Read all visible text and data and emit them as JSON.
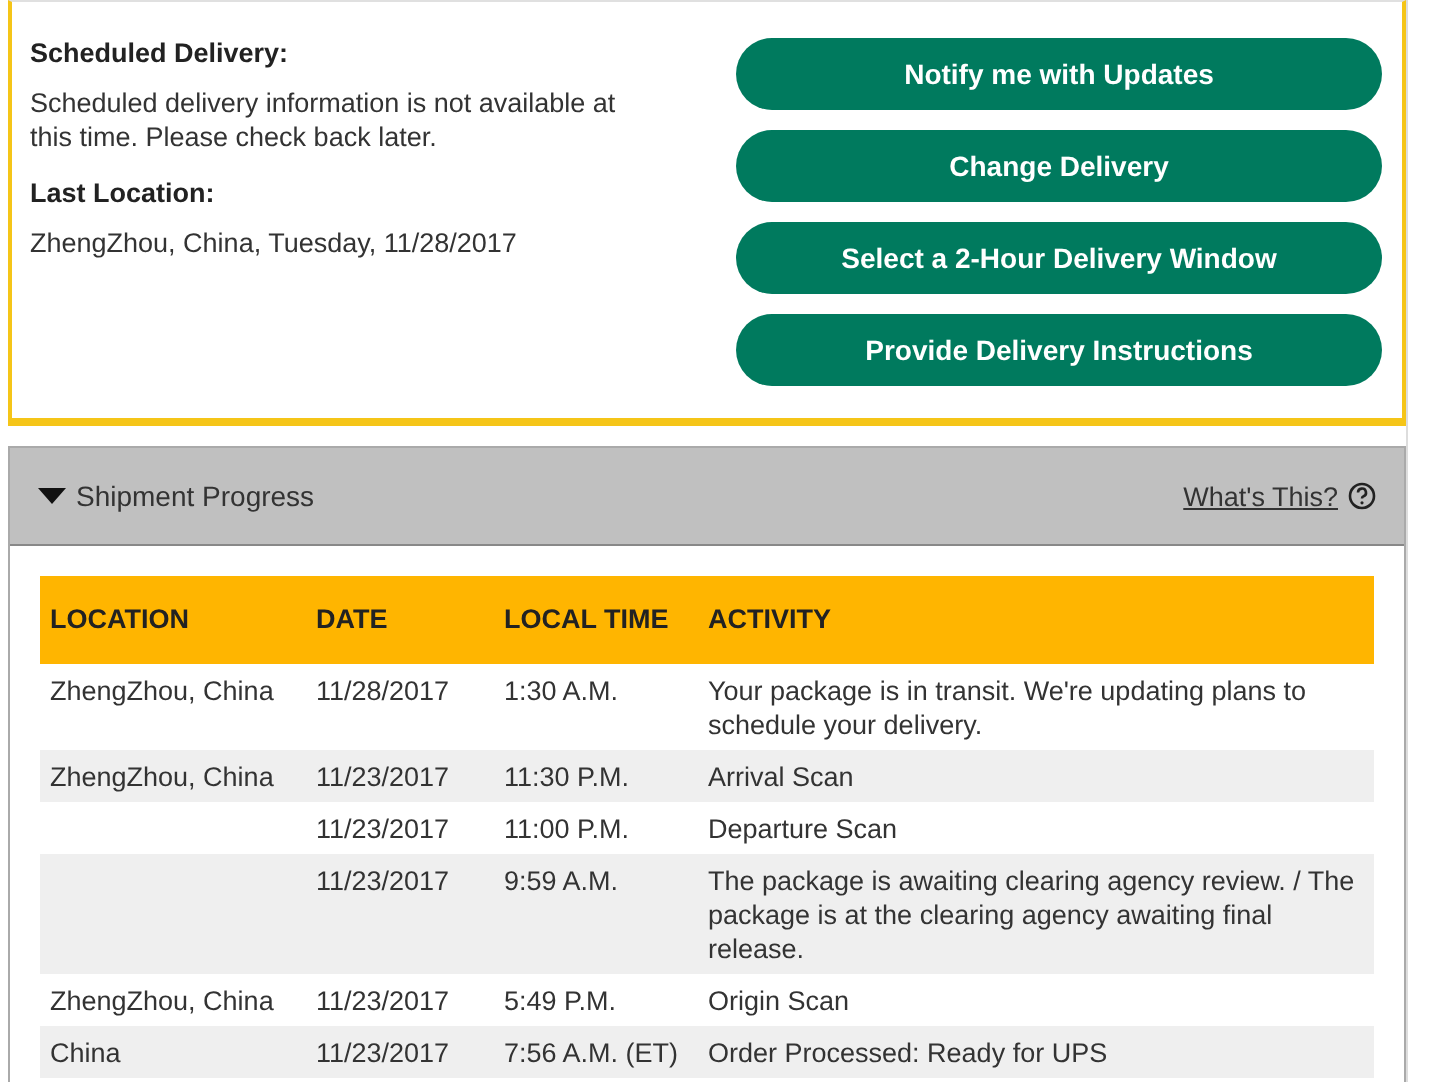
{
  "delivery": {
    "scheduled_label": "Scheduled Delivery:",
    "scheduled_text": "Scheduled delivery information is not available at this time. Please check back later.",
    "location_label": "Last Location:",
    "location_text": "ZhengZhou, China, Tuesday, 11/28/2017"
  },
  "actions": [
    "Notify me with Updates",
    "Change Delivery",
    "Select a 2-Hour Delivery Window",
    "Provide Delivery Instructions"
  ],
  "progress": {
    "title": "Shipment Progress",
    "expanded": true,
    "help_link": "What's This?",
    "columns": [
      "LOCATION",
      "DATE",
      "LOCAL TIME",
      "ACTIVITY"
    ],
    "rows": [
      {
        "location": "ZhengZhou,  China",
        "date": "11/28/2017",
        "time": "1:30 A.M.",
        "activity": "Your package is in transit. We're updating plans to schedule your delivery."
      },
      {
        "location": "ZhengZhou,  China",
        "date": "11/23/2017",
        "time": "11:30 P.M.",
        "activity": "Arrival Scan"
      },
      {
        "location": "",
        "date": "11/23/2017",
        "time": "11:00 P.M.",
        "activity": "Departure Scan"
      },
      {
        "location": "",
        "date": "11/23/2017",
        "time": "9:59 A.M.",
        "activity": "The package is awaiting clearing agency review. / The package is at the clearing agency awaiting final release."
      },
      {
        "location": "ZhengZhou,  China",
        "date": "11/23/2017",
        "time": "5:49 P.M.",
        "activity": "Origin Scan"
      },
      {
        "location": "China",
        "date": "11/23/2017",
        "time": "7:56 A.M. (ET)",
        "activity": "Order Processed: Ready for UPS"
      }
    ]
  }
}
